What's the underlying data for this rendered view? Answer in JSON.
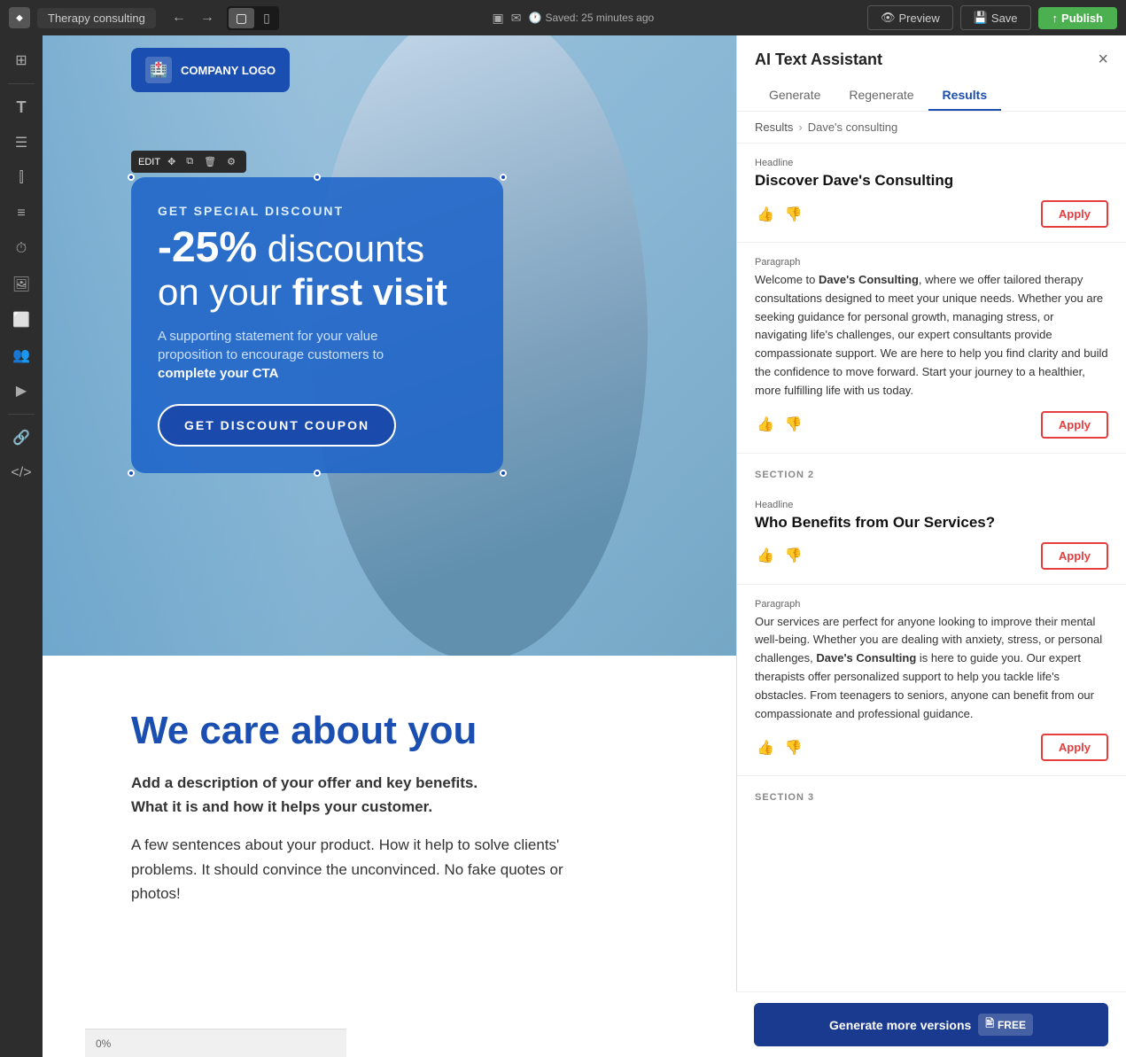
{
  "toolbar": {
    "tab_name": "Therapy consulting",
    "saved_text": "Saved: 25 minutes ago",
    "preview_label": "Preview",
    "save_label": "Save",
    "publish_label": "Publish"
  },
  "ai_panel": {
    "title": "AI Text Assistant",
    "tabs": [
      "Generate",
      "Regenerate",
      "Results"
    ],
    "active_tab": "Results",
    "breadcrumb": {
      "parent": "Results",
      "current": "Dave's consulting"
    },
    "sections": [
      {
        "id": "section-headline-1",
        "type_label": "Headline",
        "title": "Discover Dave's Consulting",
        "apply_label": "Apply"
      },
      {
        "id": "section-para-1",
        "type_label": "Paragraph",
        "text_parts": [
          "Welcome to ",
          "Dave's Consulting",
          ", where we offer tailored therapy consultations designed to meet your unique needs. Whether you are seeking guidance for personal growth, managing stress, or navigating life's challenges, our expert consultants provide compassionate support. We are here to help you find clarity and build the confidence to move forward. Start your journey to a healthier, more fulfilling life with us today."
        ],
        "apply_label": "Apply"
      },
      {
        "id": "section-2-label",
        "section_name": "SECTION 2"
      },
      {
        "id": "section-headline-2",
        "type_label": "Headline",
        "title": "Who Benefits from Our Services?",
        "apply_label": "Apply"
      },
      {
        "id": "section-para-2",
        "type_label": "Paragraph",
        "text_parts": [
          "Our services are perfect for anyone looking to improve their mental well-being. Whether you are dealing with anxiety, stress, or personal challenges, ",
          "Dave's Consulting",
          " is here to guide you. Our expert therapists offer personalized support to help you tackle life's obstacles. From teenagers to seniors, anyone can benefit from our compassionate and professional guidance."
        ],
        "apply_label": "Apply"
      },
      {
        "id": "section-3-label",
        "section_name": "SECTION 3"
      }
    ],
    "generate_more_label": "Generate more versions",
    "free_label": "FREE"
  },
  "canvas": {
    "company_logo": "COMPANY LOGO",
    "hero": {
      "discount_label": "GET SPECIAL DISCOUNT",
      "discount_amount": "-25%",
      "discount_suffix": " discounts",
      "on_your": "on your ",
      "first_visit": "first visit",
      "supporting_text_1": "A supporting statement for your value",
      "supporting_text_2": "proposition to encourage customers to",
      "cta_strong": "complete your CTA",
      "cta_button": "GET DISCOUNT COUPON"
    },
    "section_2": {
      "headline": "We care about you",
      "desc_line1": "Add a description of your offer and key benefits.",
      "desc_line2": "What it is and how it helps your customer.",
      "para": "A few sentences about your product. How it help to solve clients' problems. It should convince the unconvinced. No fake quotes or photos!"
    }
  },
  "status_bar": {
    "zoom": "0%"
  }
}
